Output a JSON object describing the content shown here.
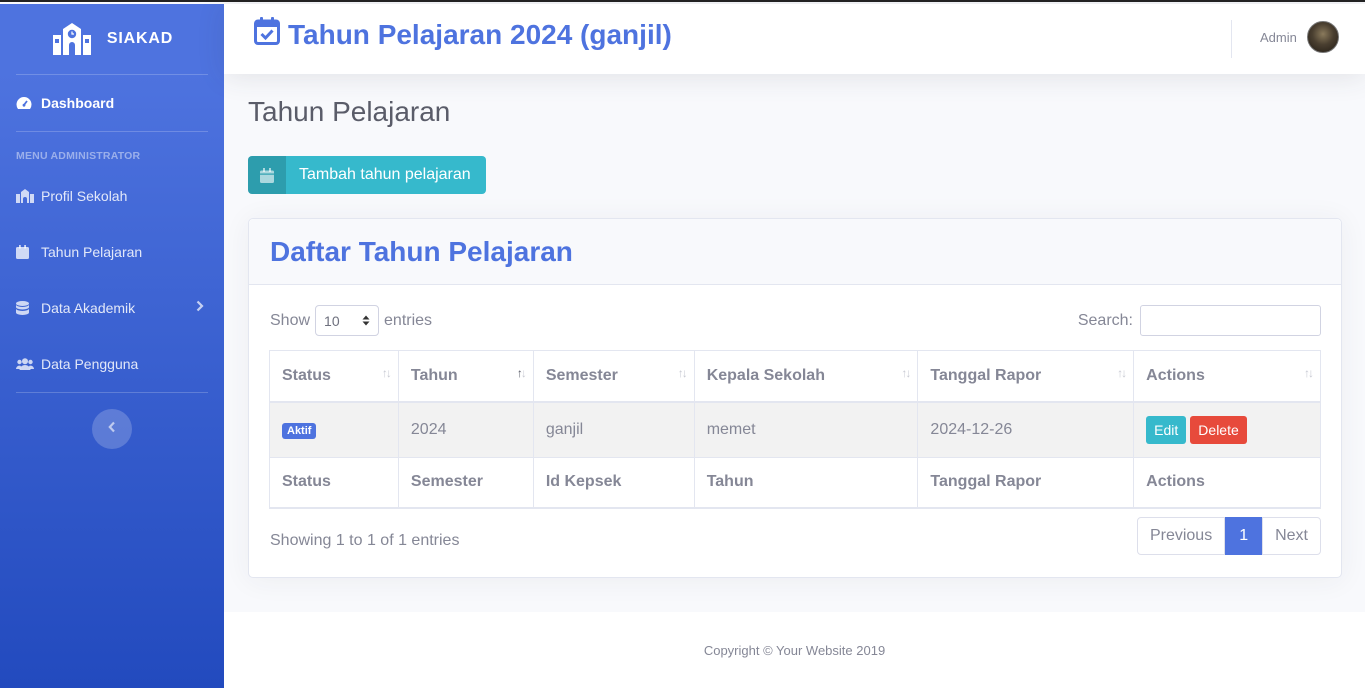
{
  "brand": {
    "name": "SIAKAD"
  },
  "sidebar": {
    "dashboard": "Dashboard",
    "heading": "MENU ADMINISTRATOR",
    "items": [
      "Profil Sekolah",
      "Tahun Pelajaran",
      "Data Akademik",
      "Data Pengguna"
    ]
  },
  "topbar": {
    "title": "Tahun Pelajaran 2024 (ganjil)",
    "user": "Admin"
  },
  "page": {
    "title": "Tahun Pelajaran",
    "add_button": "Tambah tahun pelajaran"
  },
  "card": {
    "title": "Daftar Tahun Pelajaran",
    "show_label": "Show",
    "entries_value": "10",
    "entries_label": "entries",
    "search_label": "Search:",
    "columns": [
      "Status",
      "Tahun",
      "Semester",
      "Kepala Sekolah",
      "Tanggal Rapor",
      "Actions"
    ],
    "rows": [
      {
        "status": "Aktif",
        "tahun": "2024",
        "semester": "ganjil",
        "kepala": "memet",
        "tanggal": "2024-12-26",
        "edit": "Edit",
        "delete": "Delete"
      }
    ],
    "footer_columns": [
      "Status",
      "Semester",
      "Id Kepsek",
      "Tahun",
      "Tanggal Rapor",
      "Actions"
    ],
    "info": "Showing 1 to 1 of 1 entries",
    "pagination": {
      "previous": "Previous",
      "current": "1",
      "next": "Next"
    }
  },
  "footer": {
    "copyright": "Copyright © Your Website 2019"
  },
  "colors": {
    "primary": "#4e73df",
    "info": "#36b9cc",
    "danger": "#e74a3b"
  }
}
